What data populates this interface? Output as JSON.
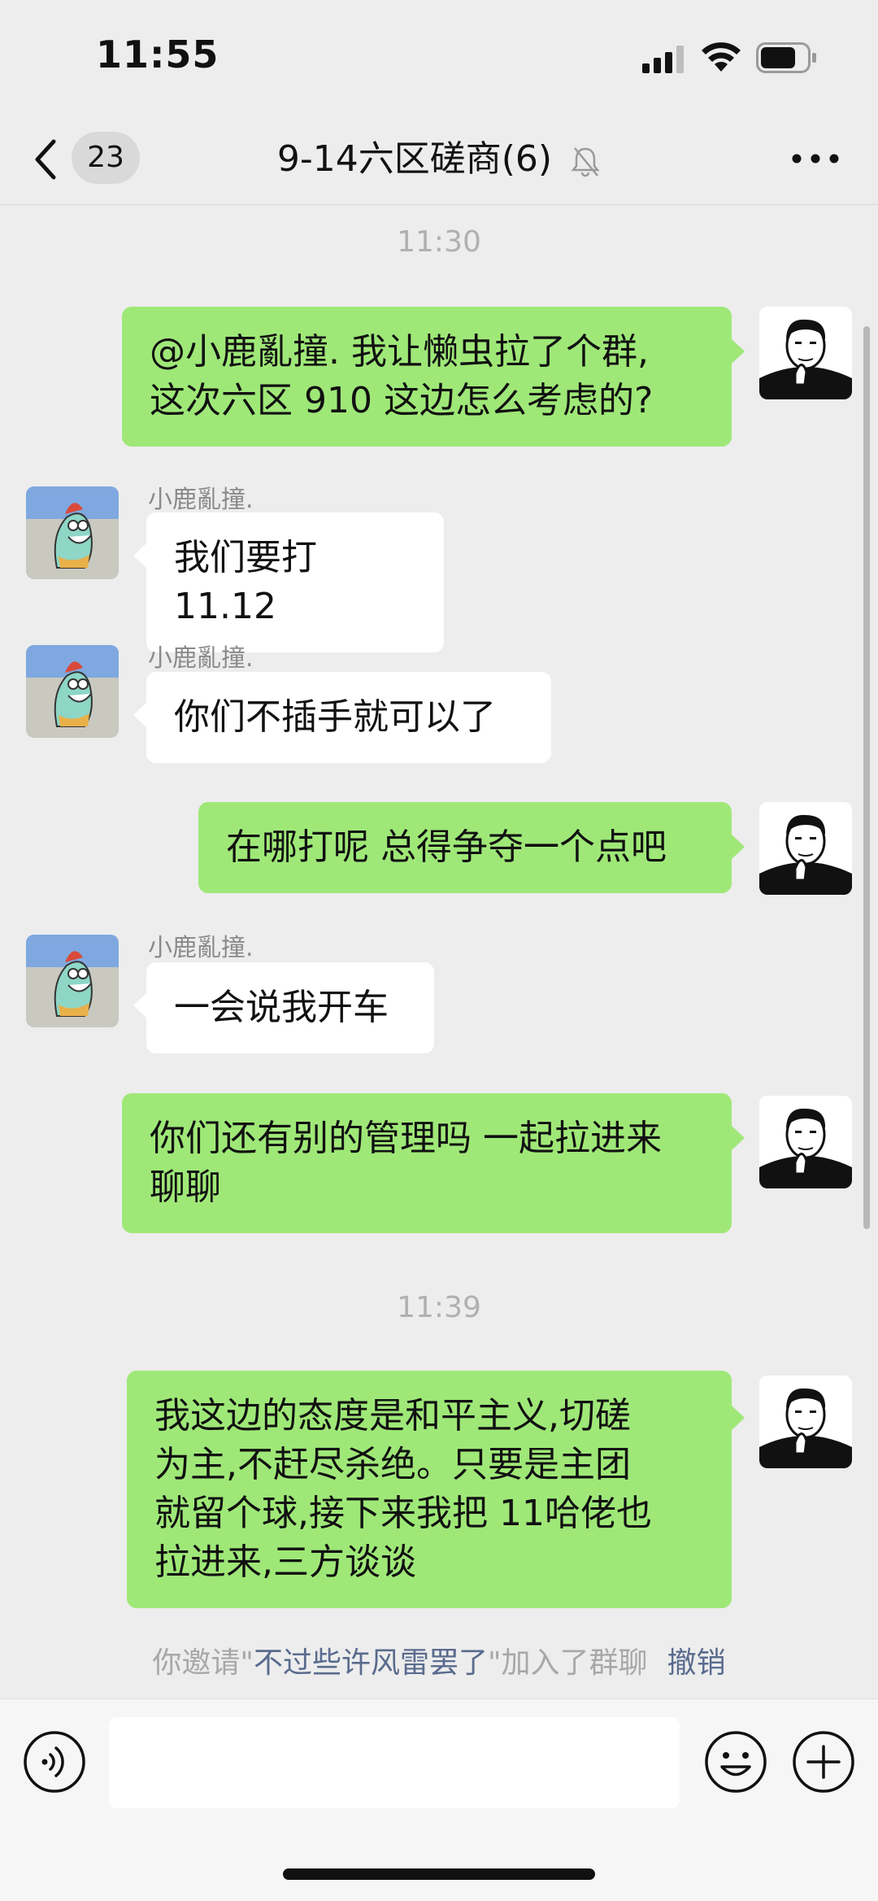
{
  "status_bar": {
    "time": "11:55"
  },
  "nav": {
    "unread_count": "23",
    "title": "9-14六区磋商(6)"
  },
  "chat": {
    "timestamps": [
      "11:30",
      "11:39"
    ],
    "messages": [
      {
        "from": "self",
        "text": "@小鹿亂撞. 我让懒虫拉了个群,\n这次六区 910 这边怎么考虑的?"
      },
      {
        "from": "other",
        "sender": "小鹿亂撞.",
        "text": "我们要打 11.12"
      },
      {
        "from": "other",
        "sender": "小鹿亂撞.",
        "text": "你们不插手就可以了"
      },
      {
        "from": "self",
        "text": "在哪打呢 总得争夺一个点吧"
      },
      {
        "from": "other",
        "sender": "小鹿亂撞.",
        "text": "一会说我开车"
      },
      {
        "from": "self",
        "text": "你们还有别的管理吗 一起拉进来\n聊聊"
      },
      {
        "from": "self",
        "text": "我这边的态度是和平主义,切磋\n为主,不赶尽杀绝。只要是主团\n就留个球,接下来我把 11哈佬也\n拉进来,三方谈谈"
      }
    ],
    "system_message": {
      "prefix": "你邀请\"",
      "invitee": "不过些许风雷罢了",
      "suffix": "\"加入了群聊",
      "action": "撤销"
    }
  },
  "input_bar": {
    "placeholder": ""
  },
  "colors": {
    "background": "#ededed",
    "self_bubble": "#9fe878",
    "other_bubble": "#ffffff",
    "link": "#5a6b8e"
  },
  "icons": [
    "signal-icon",
    "wifi-icon",
    "battery-icon",
    "back-chevron-icon",
    "mute-bell-icon",
    "more-dots-icon",
    "voice-icon",
    "emoji-icon",
    "plus-icon"
  ]
}
